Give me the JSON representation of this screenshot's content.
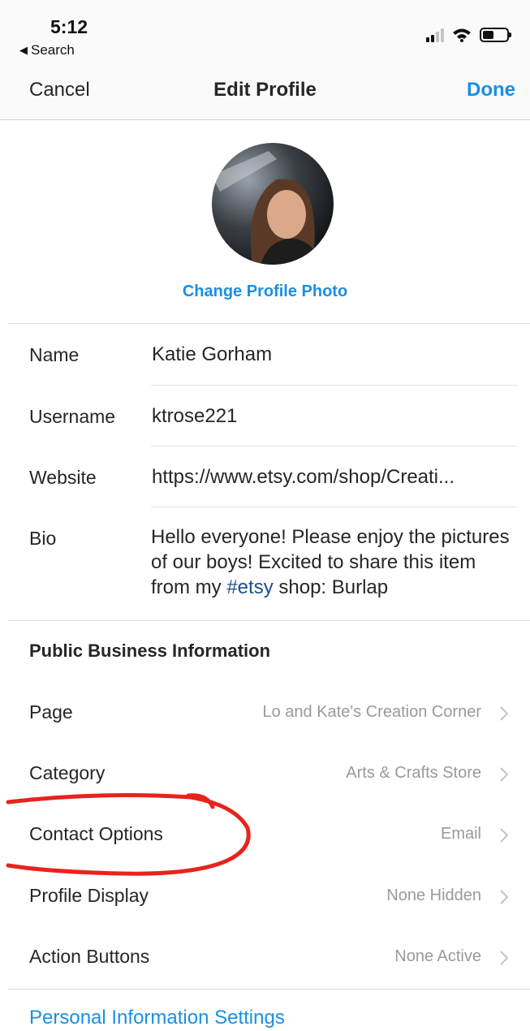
{
  "status_bar": {
    "time": "5:12",
    "back_label": "Search"
  },
  "nav": {
    "cancel_label": "Cancel",
    "title": "Edit Profile",
    "done_label": "Done"
  },
  "profile": {
    "change_photo_label": "Change Profile Photo"
  },
  "fields": {
    "name": {
      "label": "Name",
      "value": "Katie Gorham"
    },
    "username": {
      "label": "Username",
      "value": "ktrose221"
    },
    "website": {
      "label": "Website",
      "value": "https://www.etsy.com/shop/Creati..."
    },
    "bio": {
      "label": "Bio",
      "value_before": "Hello everyone! Please enjoy the pictures of our boys! Excited to share this item from my ",
      "hashtag": "#etsy",
      "value_after": " shop: Burlap"
    }
  },
  "business": {
    "section_title": "Public Business Information",
    "rows": [
      {
        "label": "Page",
        "value": "Lo and Kate's Creation Corner"
      },
      {
        "label": "Category",
        "value": "Arts & Crafts Store"
      },
      {
        "label": "Contact Options",
        "value": "Email"
      },
      {
        "label": "Profile Display",
        "value": "None Hidden"
      },
      {
        "label": "Action Buttons",
        "value": "None Active"
      }
    ]
  },
  "personal_settings_label": "Personal Information Settings",
  "colors": {
    "accent": "#1a8fe3",
    "hashtag": "#1d4f8a",
    "annotation": "#e8231c",
    "secondary_text": "#9a9a9a"
  },
  "icons": {
    "back": "back-triangle-icon",
    "signal": "cellular-signal-icon",
    "wifi": "wifi-icon",
    "battery": "battery-icon",
    "row_chevron": "chevron-right-icon"
  }
}
